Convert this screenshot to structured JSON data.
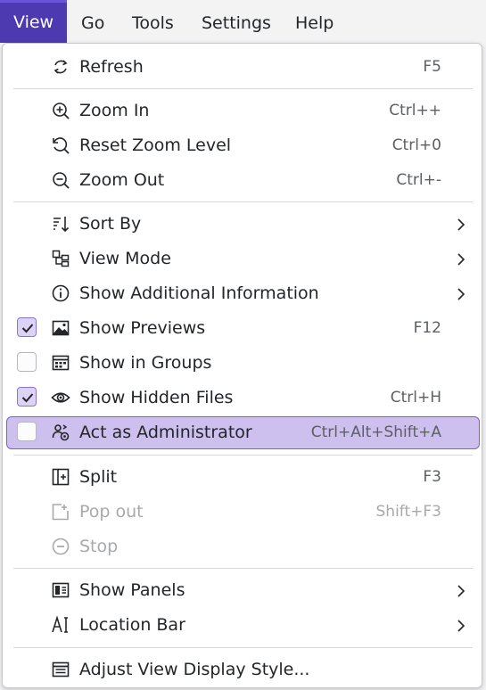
{
  "menubar": {
    "items": [
      "View",
      "Go",
      "Tools",
      "Settings",
      "Help"
    ],
    "active": "View"
  },
  "menu": {
    "items": [
      {
        "label": "Refresh",
        "shortcut": "F5",
        "icon": "refresh-icon"
      },
      {
        "label": "Zoom In",
        "shortcut": "Ctrl++",
        "icon": "zoom-in-icon"
      },
      {
        "label": "Reset Zoom Level",
        "shortcut": "Ctrl+0",
        "icon": "reset-zoom-icon"
      },
      {
        "label": "Zoom Out",
        "shortcut": "Ctrl+-",
        "icon": "zoom-out-icon"
      },
      {
        "label": "Sort By",
        "icon": "sort-icon",
        "submenu": true
      },
      {
        "label": "View Mode",
        "icon": "view-mode-icon",
        "submenu": true
      },
      {
        "label": "Show Additional Information",
        "icon": "info-icon",
        "submenu": true
      },
      {
        "label": "Show Previews",
        "shortcut": "F12",
        "icon": "image-icon",
        "checked": true
      },
      {
        "label": "Show in Groups",
        "icon": "groups-icon",
        "checked": false
      },
      {
        "label": "Show Hidden Files",
        "shortcut": "Ctrl+H",
        "icon": "eye-icon",
        "checked": true
      },
      {
        "label": "Act as Administrator",
        "shortcut": "Ctrl+Alt+Shift+A",
        "icon": "admin-icon",
        "checked": false,
        "highlighted": true
      },
      {
        "label": "Split",
        "shortcut": "F3",
        "icon": "split-icon"
      },
      {
        "label": "Pop out",
        "shortcut": "Shift+F3",
        "icon": "pop-out-icon",
        "disabled": true
      },
      {
        "label": "Stop",
        "icon": "stop-icon",
        "disabled": true
      },
      {
        "label": "Show Panels",
        "icon": "panels-icon",
        "submenu": true
      },
      {
        "label": "Location Bar",
        "icon": "location-bar-icon",
        "submenu": true
      },
      {
        "label": "Adjust View Display Style...",
        "icon": "display-style-icon"
      }
    ]
  },
  "colors": {
    "accent": "#4d3ab0",
    "highlight": "#cdbfee",
    "highlight_border": "#7c5fd4"
  }
}
